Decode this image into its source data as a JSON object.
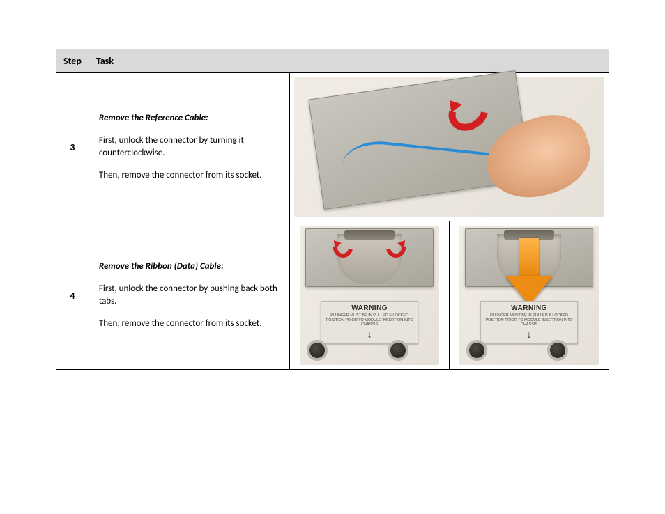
{
  "headers": {
    "step": "Step",
    "task": "Task"
  },
  "rows": [
    {
      "num": "3",
      "title": "Remove the Reference Cable:",
      "p1": "First, unlock the connector by turning it counterclockwise.",
      "p2": "Then,  remove the connector from its socket."
    },
    {
      "num": "4",
      "title": "Remove the Ribbon (Data) Cable:",
      "p1": "First, unlock the connector by pushing back both tabs.",
      "p2": "Then, remove the connector from its socket."
    }
  ],
  "warning_label": {
    "title": "WARNING",
    "body": "PLUNGER MUST BE IN PULLED & LOCKED POSITION PRIOR TO MODULE INSERTION INTO CHASSIS"
  }
}
